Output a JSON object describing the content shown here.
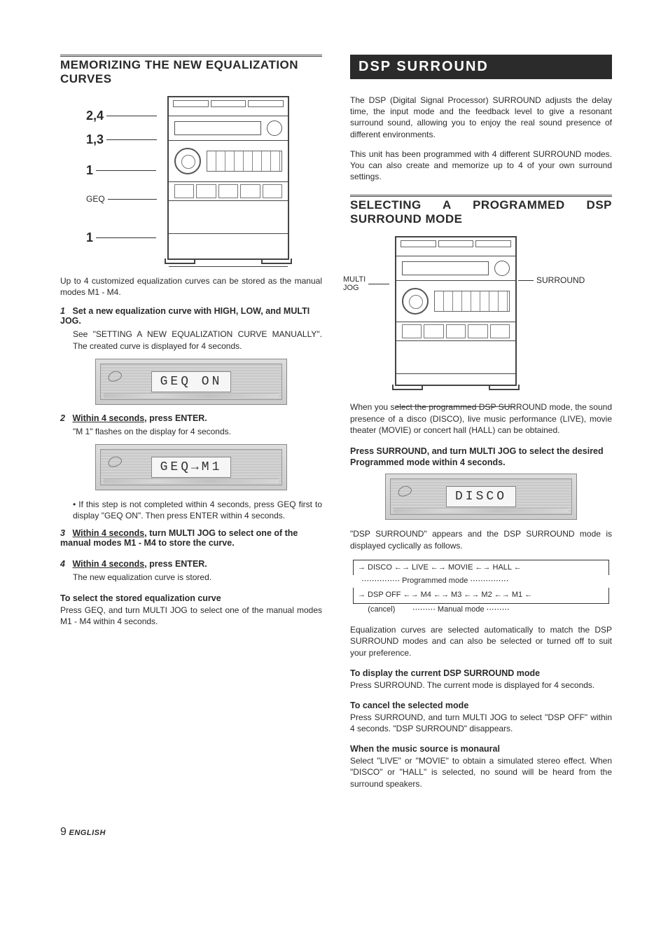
{
  "left": {
    "heading": "MEMORIZING THE NEW EQUALIZATION CURVES",
    "diagram": {
      "c1": "2,4",
      "c2": "1,3",
      "c3": "1",
      "c4": "GEQ",
      "c5": "1"
    },
    "intro": "Up to 4 customized equalization curves can be stored as the manual modes M1 - M4.",
    "step1": {
      "n": "1",
      "title": "Set a new equalization curve with HIGH, LOW, and MULTI JOG.",
      "body": "See \"SETTING A NEW EQUALIZATION CURVE MANUALLY\". The created curve is displayed for 4 seconds."
    },
    "lcd1": "GEQ ON",
    "step2": {
      "n": "2",
      "title_u": "Within 4 seconds,",
      "title_r": " press ENTER.",
      "body": "\"M 1\" flashes on the display for 4 seconds."
    },
    "lcd2": "GEQ→M1",
    "note2": "If this step is not completed within 4 seconds, press GEQ first to display \"GEQ ON\". Then press ENTER within 4 seconds.",
    "step3": {
      "n": "3",
      "title_u": "Within 4 seconds,",
      "title_r": " turn MULTI JOG to select one of the manual modes M1 - M4 to store the curve."
    },
    "step4": {
      "n": "4",
      "title_u": "Within 4 seconds,",
      "title_r": " press ENTER.",
      "body": "The new equalization curve is stored."
    },
    "select": {
      "h": "To select the stored equalization curve",
      "body": "Press GEQ, and turn MULTI JOG to select one of the manual modes M1 - M4 within 4 seconds."
    }
  },
  "right": {
    "bar": "DSP SURROUND",
    "intro1": "The DSP (Digital Signal Processor) SURROUND adjusts the delay time, the input mode and the feedback level to give a resonant surround sound, allowing you to enjoy the real sound presence of different environments.",
    "intro2": "This unit has been programmed with 4 different SURROUND modes. You can also create and memorize up to 4 of your own surround settings.",
    "heading": "SELECTING A PROGRAMMED DSP SURROUND MODE",
    "diagram": {
      "left": "MULTI\nJOG",
      "right": "SURROUND"
    },
    "para1": "When you select the programmed DSP SURROUND mode, the sound presence of a disco (DISCO), live music performance (LIVE), movie theater (MOVIE) or concert hall (HALL) can be obtained.",
    "instr": "Press SURROUND, and turn MULTI JOG to select the desired Programmed mode within 4 seconds.",
    "lcd": "DISCO",
    "para2": "\"DSP SURROUND\" appears and the DSP SURROUND mode is displayed cyclically as follows.",
    "cycle_row1": "→ DISCO ←→ LIVE ←→ MOVIE ←→ HALL ←",
    "cycle_row1b": "  ⋯⋯⋯⋯⋯ Programmed mode ⋯⋯⋯⋯⋯",
    "cycle_row2": "→ DSP OFF ←→ M4 ←→ M3 ←→ M2 ←→ M1 ←",
    "cycle_row2b": "     (cancel)        ⋯⋯⋯ Manual mode ⋯⋯⋯",
    "para3": "Equalization curves are selected automatically to match the DSP SURROUND modes and can also be selected or turned off to suit your preference.",
    "disp": {
      "h": "To display the current DSP SURROUND mode",
      "b": "Press SURROUND. The current mode is displayed for 4 seconds."
    },
    "cancel": {
      "h": "To cancel the selected mode",
      "b": "Press SURROUND, and turn MULTI JOG to select \"DSP OFF\" within 4 seconds. \"DSP SURROUND\" disappears."
    },
    "mono": {
      "h": "When the music source is monaural",
      "b": "Select \"LIVE\" or \"MOVIE\" to obtain a simulated stereo effect. When \"DISCO\" or \"HALL\" is selected, no sound will be heard from the surround speakers."
    }
  },
  "footer": {
    "page": "9",
    "lang": "ENGLISH"
  }
}
